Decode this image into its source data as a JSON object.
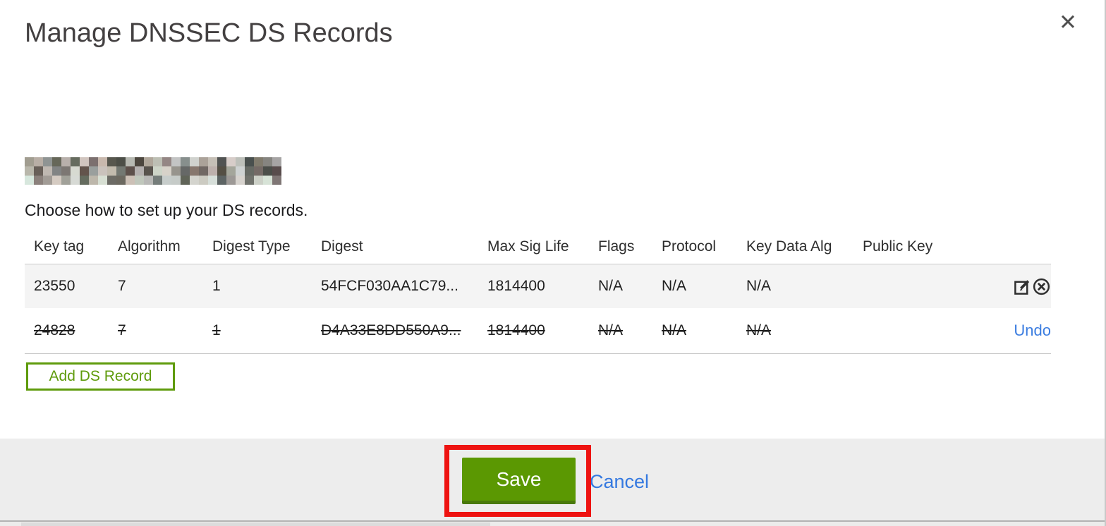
{
  "modal": {
    "title": "Manage DNSSEC DS Records",
    "close_icon": "✕",
    "domain_redacted": true,
    "subtitle": "Choose how to set up your DS records."
  },
  "table": {
    "headers": [
      "Key tag",
      "Algorithm",
      "Digest Type",
      "Digest",
      "Max Sig Life",
      "Flags",
      "Protocol",
      "Key Data Alg",
      "Public Key"
    ],
    "rows": [
      {
        "key_tag": "23550",
        "algorithm": "7",
        "digest_type": "1",
        "digest": "54FCF030AA1C79...",
        "max_sig_life": "1814400",
        "flags": "N/A",
        "protocol": "N/A",
        "key_data_alg": "N/A",
        "public_key": "",
        "state": "active",
        "actions": [
          "edit-icon",
          "delete-icon"
        ]
      },
      {
        "key_tag": "24828",
        "algorithm": "7",
        "digest_type": "1",
        "digest": "D4A33E8DD550A9...",
        "max_sig_life": "1814400",
        "flags": "N/A",
        "protocol": "N/A",
        "key_data_alg": "N/A",
        "public_key": "",
        "state": "marked-for-deletion",
        "undo_label": "Undo"
      }
    ]
  },
  "buttons": {
    "add_ds_record": "Add DS Record",
    "save": "Save",
    "cancel": "Cancel"
  },
  "annotation": {
    "type": "highlight-box",
    "target": "save-button",
    "color": "#ee1311"
  },
  "colors": {
    "primary_green": "#5b9802",
    "outline_green": "#5f9b0c",
    "link_blue": "#3b7de0",
    "footer_gray": "#ededed",
    "row_stripe_gray": "#f4f4f4",
    "annotation_red": "#ee1311"
  }
}
